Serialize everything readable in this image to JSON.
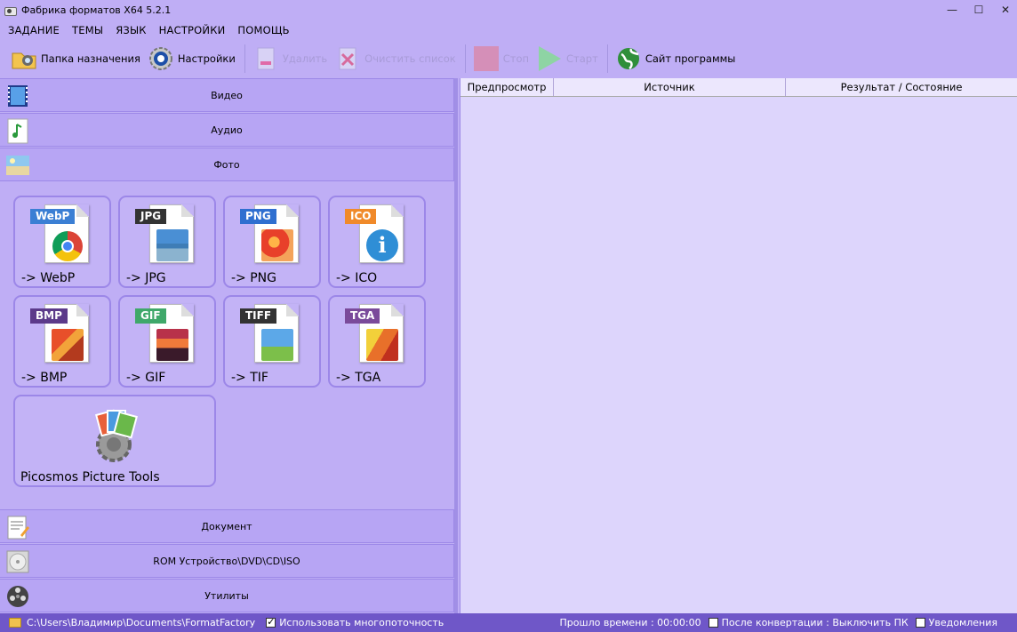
{
  "window": {
    "title": "Фабрика форматов X64 5.2.1"
  },
  "menu": [
    "ЗАДАНИЕ",
    "ТЕМЫ",
    "ЯЗЫК",
    "НАСТРОЙКИ",
    "ПОМОЩЬ"
  ],
  "toolbar": {
    "output_folder": "Папка назначения",
    "settings": "Настройки",
    "delete": "Удалить",
    "clear_list": "Очистить список",
    "stop": "Стоп",
    "start": "Старт",
    "website": "Сайт программы"
  },
  "categories": {
    "video": "Видео",
    "audio": "Аудио",
    "photo": "Фото",
    "document": "Документ",
    "rom": "ROM Устройство\\DVD\\CD\\ISO",
    "utilities": "Утилиты"
  },
  "formats": [
    {
      "badge": "WebP",
      "label": "-> WebP",
      "color": "#3b7fd4"
    },
    {
      "badge": "JPG",
      "label": "-> JPG",
      "color": "#333333"
    },
    {
      "badge": "PNG",
      "label": "-> PNG",
      "color": "#2f6fd0"
    },
    {
      "badge": "ICO",
      "label": "-> ICO",
      "color": "#f08a2a"
    },
    {
      "badge": "BMP",
      "label": "-> BMP",
      "color": "#5c3a8a"
    },
    {
      "badge": "GIF",
      "label": "-> GIF",
      "color": "#3fa86a"
    },
    {
      "badge": "TIFF",
      "label": "-> TIF",
      "color": "#333333"
    },
    {
      "badge": "TGA",
      "label": "-> TGA",
      "color": "#7a4a9a"
    }
  ],
  "tools": {
    "picosmos": "Picosmos Picture Tools"
  },
  "grid": {
    "columns": [
      "Предпросмотр",
      "Источник",
      "Результат / Состояние"
    ]
  },
  "status": {
    "path": "C:\\Users\\Владимир\\Documents\\FormatFactory",
    "multithread": "Использовать многопоточность",
    "elapsed": "Прошло времени : 00:00:00",
    "after_convert": "После конвертации : Выключить ПК",
    "notifications": "Уведомления"
  }
}
